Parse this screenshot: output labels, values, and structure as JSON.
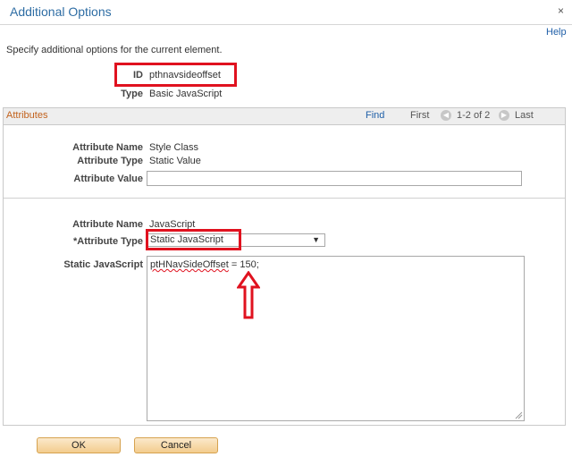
{
  "window": {
    "title": "Additional Options",
    "close_glyph": "×"
  },
  "help_link": "Help",
  "intro_text": "Specify additional options for the current element.",
  "element": {
    "id_label": "ID",
    "id_value": "pthnavsideoffset",
    "type_label": "Type",
    "type_value": "Basic JavaScript"
  },
  "attributes_panel": {
    "title": "Attributes",
    "find": "Find",
    "first": "First",
    "range": "1-2 of 2",
    "last": "Last",
    "row1": {
      "name_label": "Attribute Name",
      "name_value": "Style Class",
      "type_label": "Attribute Type",
      "type_value": "Static Value",
      "value_label": "Attribute Value",
      "value_value": ""
    },
    "row2": {
      "name_label": "Attribute Name",
      "name_value": "JavaScript",
      "type_label": "*Attribute Type",
      "type_selected": "Static JavaScript",
      "script_label": "Static JavaScript",
      "script_token": "ptHNavSideOffset",
      "script_rest": " = 150;"
    }
  },
  "buttons": {
    "ok": "OK",
    "cancel": "Cancel"
  },
  "colors": {
    "title": "#2e6da4",
    "link": "#1f5fa8",
    "panel_title": "#c2621d",
    "highlight": "#e0121f",
    "button": "#f3cc8d"
  },
  "icons": [
    "close-icon",
    "nav-prev-icon",
    "nav-next-icon",
    "dropdown-arrow-icon",
    "resize-grip-icon",
    "annotation-up-arrow-icon"
  ]
}
